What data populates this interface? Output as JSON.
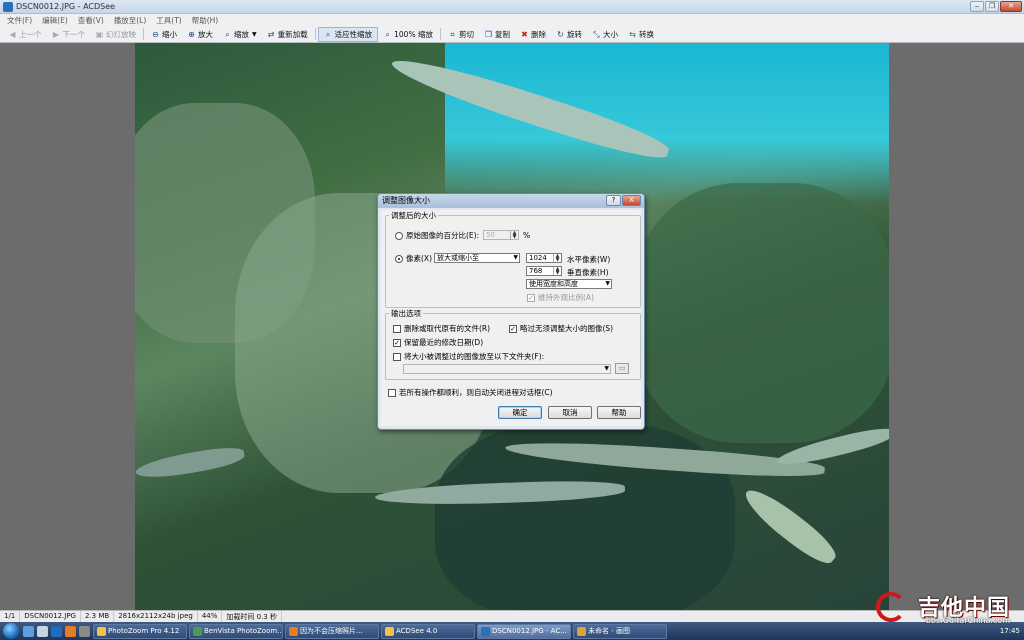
{
  "window": {
    "title": "DSCN0012.JPG - ACDSee"
  },
  "menu": [
    "文件(F)",
    "编辑(E)",
    "查看(V)",
    "播放至(L)",
    "工具(T)",
    "帮助(H)"
  ],
  "toolbar": {
    "prev": "上一个",
    "next": "下一个",
    "slideshow": "幻灯放映",
    "zoom_out": "缩小",
    "zoom_in": "放大",
    "zoom": "缩放",
    "reload": "重新加载",
    "fit": "适应性缩放",
    "actual": "100% 缩放",
    "crop": "剪切",
    "copy": "复制",
    "delete": "删除",
    "rotate": "旋转",
    "resize": "大小",
    "convert": "转换"
  },
  "dialog": {
    "title": "调整图像大小",
    "help_btn": "?",
    "close_btn": "X",
    "size_group": "调整后的大小",
    "percent_label": "原始图像的百分比(E):",
    "percent_value": "50",
    "percent_unit": "%",
    "pixels_label": "像素(X)",
    "pixels_mode": "放大或缩小至",
    "width_value": "1024",
    "width_label": "水平像素(W)",
    "height_value": "768",
    "height_label": "垂直像素(H)",
    "fit_mode": "使用宽度和高度",
    "keep_aspect": "维持外观比例(A)",
    "output_group": "输出选项",
    "opt_delete_original": "删除或取代原有的文件(R)",
    "opt_skip": "略过无须调整大小的图像(S)",
    "opt_keep_date": "保留最近的修改日期(D)",
    "opt_save_folder": "将大小被调整过的图像放至以下文件夹(F):",
    "folder_value": "",
    "auto_close": "若所有操作都顺利，则自动关闭进程对话框(C)",
    "ok": "确定",
    "cancel": "取消",
    "help": "帮助"
  },
  "status": {
    "index": "1/1",
    "file": "DSCN0012.JPG",
    "size": "2.3 MB",
    "dims": "2816x2112x24b jpeg",
    "zoom": "44%",
    "load": "加载时间 0.3 秒"
  },
  "taskbar": {
    "tasks": [
      "PhotoZoom Pro 4.12",
      "BenVista PhotoZoom...",
      "因为不会压缩照片...",
      "ACDSee 4.0",
      "DSCN0012.JPG - AC...",
      "未命名 - 画图"
    ],
    "clock": "17:45"
  },
  "watermark": {
    "big": "吉他中国",
    "small": "bbs.GuitarChina.com"
  }
}
